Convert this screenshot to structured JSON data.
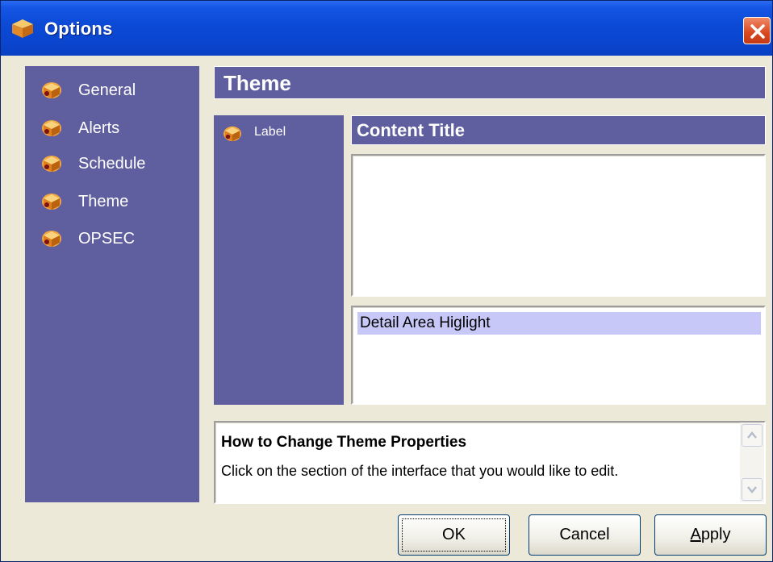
{
  "window": {
    "title": "Options",
    "icon": "package-icon"
  },
  "nav": {
    "items": [
      {
        "label": "General",
        "icon": "package-icon"
      },
      {
        "label": "Alerts",
        "icon": "package-icon"
      },
      {
        "label": "Schedule",
        "icon": "package-icon"
      },
      {
        "label": "Theme",
        "icon": "package-icon"
      },
      {
        "label": "OPSEC",
        "icon": "package-icon"
      }
    ]
  },
  "main": {
    "header": "Theme",
    "label_panel": {
      "label": "Label",
      "icon": "package-icon"
    },
    "content_title": "Content Title",
    "detail_highlight": "Detail Area Higlight"
  },
  "help": {
    "title": "How to Change Theme Properties",
    "body": "Click on the section of the interface that you would like to edit."
  },
  "buttons": {
    "ok": "OK",
    "cancel": "Cancel",
    "apply_first": "A",
    "apply_rest": "pply"
  },
  "colors": {
    "panel": "#5f5e9e",
    "titlebar": "#0a46d0",
    "highlight": "#c8c8f8",
    "dialog": "#ece9d8"
  }
}
